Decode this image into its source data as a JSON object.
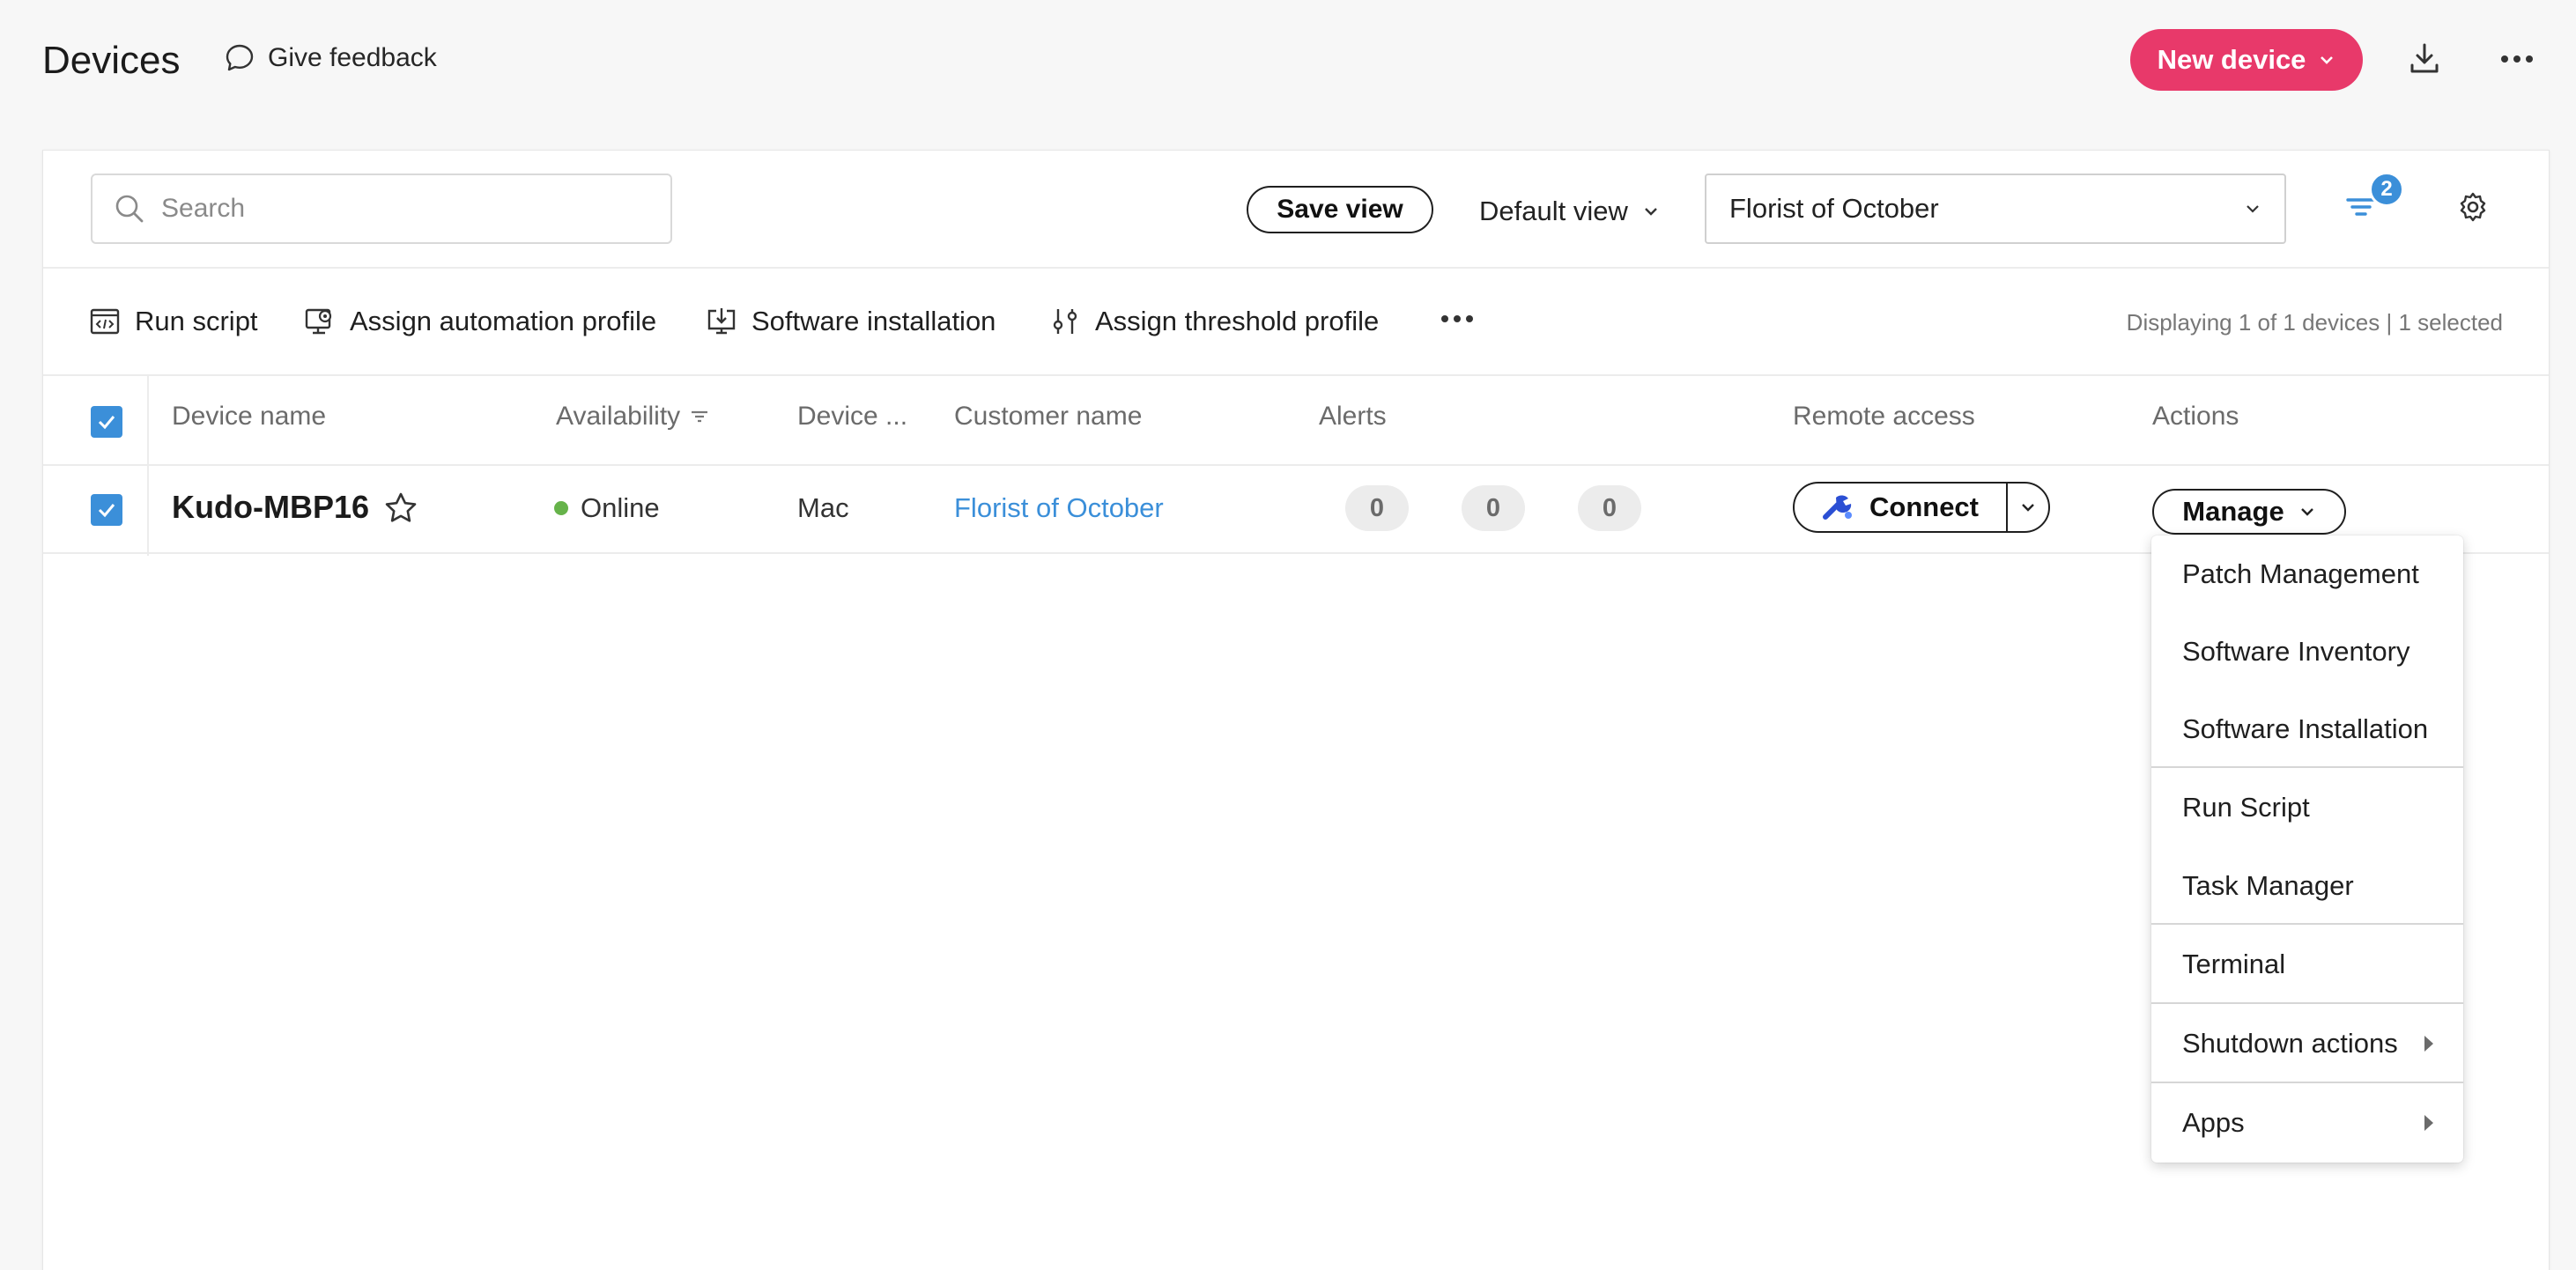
{
  "header": {
    "title": "Devices",
    "feedback_label": "Give feedback",
    "new_device_label": "New device"
  },
  "filters": {
    "search_placeholder": "Search",
    "save_view_label": "Save view",
    "view_selected": "Default view",
    "customer_selected": "Florist of October",
    "filter_count": "2"
  },
  "toolbar": {
    "run_script": "Run script",
    "assign_automation_profile": "Assign automation profile",
    "software_installation": "Software installation",
    "assign_threshold_profile": "Assign threshold profile",
    "display_count": "Displaying 1 of 1 devices | 1 selected"
  },
  "table": {
    "columns": [
      "Device name",
      "Availability",
      "Device ...",
      "Customer name",
      "Alerts",
      "Remote access",
      "Actions"
    ],
    "rows": [
      {
        "device_name": "Kudo-MBP16",
        "availability": "Online",
        "device_type": "Mac",
        "customer": "Florist of October",
        "alerts": [
          "0",
          "0",
          "0"
        ],
        "connect_label": "Connect",
        "manage_label": "Manage"
      }
    ]
  },
  "manage_menu": {
    "items": [
      "Patch Management",
      "Software Inventory",
      "Software Installation",
      "Run Script",
      "Task Manager",
      "Terminal",
      "Shutdown actions",
      "Apps"
    ]
  },
  "colors": {
    "accent": "#e8396a",
    "link": "#3b8fd9",
    "online": "#66b34a"
  }
}
